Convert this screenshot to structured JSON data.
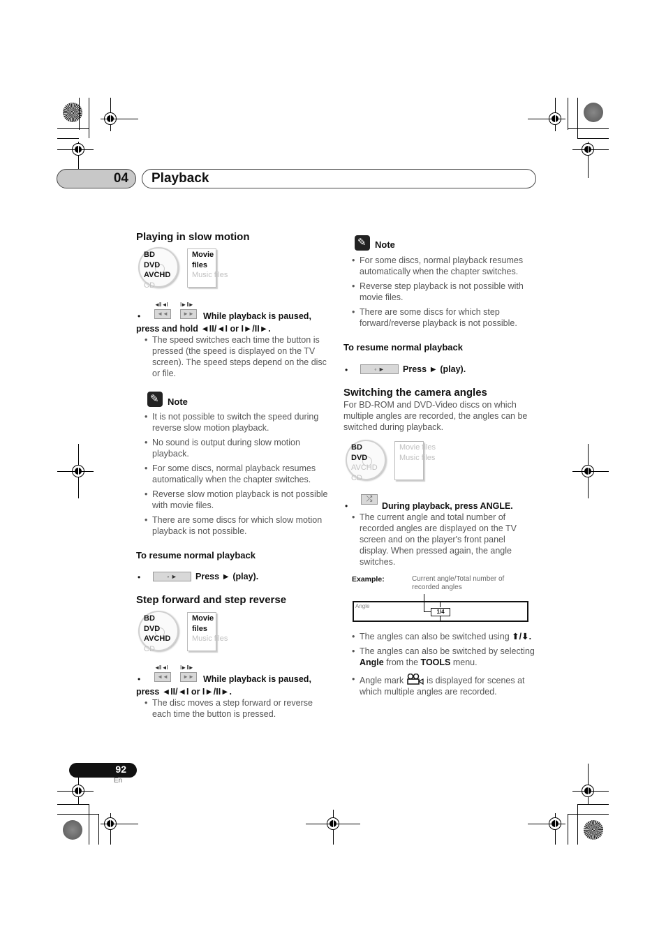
{
  "header": {
    "chapter_number": "04",
    "chapter_title": "Playback"
  },
  "compat_labels": {
    "bd": "BD",
    "dvd": "DVD",
    "avchd": "AVCHD",
    "cd": "CD",
    "movie_files": "Movie files",
    "music_files": "Music files"
  },
  "left": {
    "slow_motion": {
      "heading": "Playing in slow motion",
      "key_caps": [
        "◄II ◄I",
        "I► II►"
      ],
      "key_glyphs": [
        "◄◄",
        "►►"
      ],
      "instruction_line1": "While playback is paused,",
      "instruction_line2": "press and hold ◄II/◄I or I►/II►.",
      "bullets": [
        "The speed switches each time the button is pressed (the speed is displayed on the TV screen). The speed steps depend on the disc or file."
      ],
      "note_label": "Note",
      "notes": [
        "It is not possible to switch the speed during reverse slow motion playback.",
        "No sound is output during slow motion playback.",
        "For some discs, normal playback resumes automatically when the chapter switches.",
        "Reverse slow motion playback is not possible with movie files.",
        "There are some discs for which slow motion playback is not possible."
      ],
      "resume_heading": "To resume normal playback",
      "resume_key": "◦ ►",
      "resume_text": "Press ► (play)."
    },
    "step": {
      "heading": "Step forward and step reverse",
      "key_caps": [
        "◄II ◄I",
        "I► II►"
      ],
      "key_glyphs": [
        "◄◄",
        "►►"
      ],
      "instruction_line1": "While playback is paused,",
      "instruction_line2": "press ◄II/◄I or I►/II►.",
      "bullets": [
        "The disc moves a step forward or reverse each time the button is pressed."
      ]
    }
  },
  "right": {
    "note_label": "Note",
    "notes": [
      "For some discs, normal playback resumes automatically when the chapter switches.",
      "Reverse step playback is not possible with movie files.",
      "There are some discs for which step forward/reverse playback is not possible."
    ],
    "resume_heading": "To resume normal playback",
    "resume_key": "◦ ►",
    "resume_text": "Press ► (play).",
    "angles": {
      "heading": "Switching the camera angles",
      "intro": "For BD-ROM and DVD-Video discs on which multiple angles are recorded, the angles can be switched during playback.",
      "key_glyph": "⤮",
      "instruction": "During playback, press ANGLE.",
      "bullet_main": "The current angle and total number of recorded angles are displayed on the TV screen and on the player's front panel display. When pressed again, the angle switches.",
      "example_label": "Example:",
      "example_desc": "Current angle/Total number of recorded angles",
      "example_screen_label": "Angle",
      "example_value": "1/4",
      "bullet_arrows_pre": "The angles can also be switched using ",
      "bullet_arrows_icons": "⬆/⬇.",
      "bullet_tools_pre": "The angles can also be switched by selecting ",
      "bullet_tools_angle": "Angle",
      "bullet_tools_mid": " from the ",
      "bullet_tools_tools": "TOOLS",
      "bullet_tools_post": " menu.",
      "bullet_mark_pre": "Angle mark ",
      "bullet_mark_post": " is displayed for scenes at which multiple angles are recorded."
    }
  },
  "footer": {
    "page_number": "92",
    "language": "En"
  }
}
